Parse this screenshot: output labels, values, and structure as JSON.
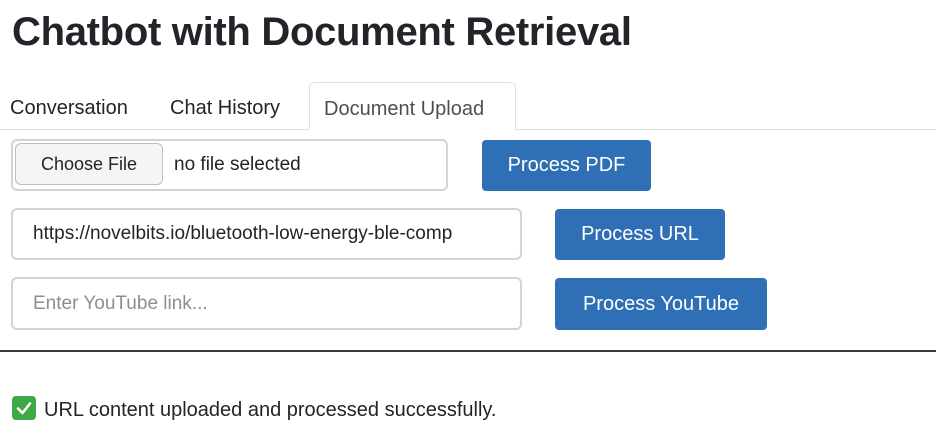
{
  "page_title": "Chatbot with Document Retrieval",
  "tabs": [
    {
      "label": "Conversation",
      "active": false
    },
    {
      "label": "Chat History",
      "active": false
    },
    {
      "label": "Document Upload",
      "active": true
    }
  ],
  "pdf": {
    "choose_label": "Choose File",
    "file_status": "no file selected",
    "button_label": "Process PDF"
  },
  "url": {
    "value": "https://novelbits.io/bluetooth-low-energy-ble-comp",
    "placeholder": "",
    "button_label": "Process URL"
  },
  "youtube": {
    "value": "",
    "placeholder": "Enter YouTube link...",
    "button_label": "Process YouTube"
  },
  "status": {
    "icon": "check-mark-icon",
    "message": "URL content uploaded and processed successfully."
  },
  "colors": {
    "primary_button": "#2f6fb5",
    "success_icon": "#3ea845"
  }
}
